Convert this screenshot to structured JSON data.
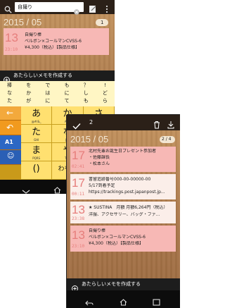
{
  "left_screen": {
    "search": {
      "value": "自撮り"
    },
    "year_month": "2015 / 05",
    "page_counter": "1",
    "card": {
      "day": "13",
      "time": "23:10",
      "line1": "自撮り棒",
      "line2": "ベルボン×コールマンCVSS-6",
      "line3": "¥4,300（税込）【製品仕様】"
    },
    "new_memo_label": "あたらしいメモを作成する",
    "candidates": [
      "棒",
      "を",
      "で",
      "も",
      "？",
      "!",
      "な",
      "か",
      "は",
      "に",
      "し",
      "ど",
      "た",
      "が",
      "に",
      "て",
      "も",
      "ら"
    ],
    "kana_rows": [
      [
        {
          "k": "あ",
          "s": "@#/&_"
        },
        {
          "k": "か",
          "s": "ABC"
        },
        {
          "k": "さ",
          "s": "DEF"
        }
      ],
      [
        {
          "k": "た",
          "s": "GHI"
        },
        {
          "k": "な",
          "s": "JKL"
        },
        {
          "k": "は",
          "s": "MNO"
        }
      ],
      [
        {
          "k": "ま",
          "s": "PQRS"
        },
        {
          "k": "や",
          "s": "TUV"
        },
        {
          "k": "ら",
          "s": "WXYZ"
        }
      ],
      [
        {
          "k": "()",
          "s": ""
        },
        {
          "k": "わをん",
          "s": ""
        },
        {
          "k": "、。?!",
          "s": ""
        }
      ]
    ],
    "mode_key": "A1",
    "emoji_key": "☺",
    "left_arrow": "←",
    "undo": "↶"
  },
  "right_screen": {
    "selected_count": "2",
    "year_month": "2015 / 05",
    "page_counter": "2 / 4",
    "cards": [
      {
        "day": "17",
        "time": "02:41",
        "lines": [
          "北村先輩お誕生日プレゼント参加者",
          "・佐藤課長",
          "・松本さん"
        ]
      },
      {
        "day": "17",
        "time": "00:11",
        "lines": [
          "書留追跡番号000-00-00000-00",
          "5/17到着予定",
          "https://trackings.post.japanpost.jp..."
        ]
      },
      {
        "day": "13",
        "time": "23:38",
        "lines": [
          "★ SUSTINA　月額 月額6,264円（税込）",
          "洋服、アクセサリー、バッグ・ファ..."
        ]
      },
      {
        "day": "13",
        "time": "23:10",
        "lines": [
          "自撮り棒",
          "ベルボン×コールマンCVSS-6",
          "¥4,300（税込）【製品仕様】"
        ]
      }
    ],
    "new_memo_label": "あたらしいメモを作成する"
  },
  "colors": {
    "accent": "#e67e7c",
    "card_bg": "#f7b8b5",
    "keyboard_yellow": "#ffe070",
    "keyboard_orange": "#f19a1e",
    "bar_dark": "#1d1d1d"
  }
}
